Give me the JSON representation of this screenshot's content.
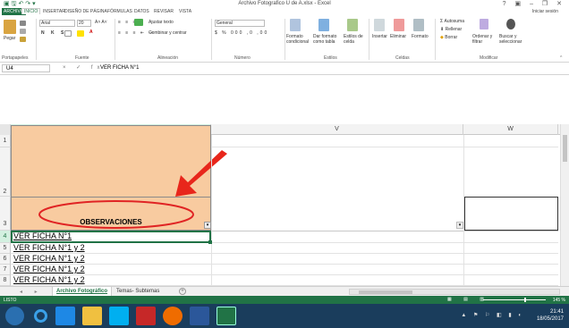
{
  "window": {
    "title": "Archivo Fotografico U de A.xlsx - Excel",
    "controls": "? ▣ – ❐ ✕"
  },
  "tabs": [
    "ARCHIVO",
    "INICIO",
    "INSERTAR",
    "DISEÑO DE PÁGINA",
    "FÓRMULAS",
    "DATOS",
    "REVISAR",
    "VISTA"
  ],
  "signin": "Iniciar sesión",
  "ribbon": {
    "paste": "Pegar",
    "font_name": "Arial",
    "font_size": "20",
    "wrap": "Ajustar texto",
    "merge": "Combinar y centrar",
    "number_format": "General",
    "cond_format": "Formato condicional",
    "as_table": "Dar formato como tabla",
    "cell_styles": "Estilos de celda",
    "insert": "Insertar",
    "delete": "Eliminar",
    "format": "Formato",
    "autosum": "Autosuma",
    "fill": "Rellenar",
    "clear": "Borrar",
    "sort": "Ordenar y filtrar",
    "find": "Buscar y seleccionar",
    "groups": [
      "Portapapeles",
      "Fuente",
      "Alineación",
      "Número",
      "Estilos",
      "Celdas",
      "Modificar"
    ]
  },
  "formula_bar": {
    "name_box": "U4",
    "fx": "× ✓ fx",
    "content": "VER FICHA N°1"
  },
  "columns": [
    "U",
    "V",
    "W"
  ],
  "rows": [
    "1",
    "2",
    "3",
    "4",
    "5",
    "6",
    "7",
    "8"
  ],
  "header_cell": "OBSERVACIONES",
  "data_cells": [
    "VER FICHA N°1",
    "VER FICHA N°1 y 2",
    "VER FICHA N°1 y 2",
    "VER FICHA N°1 y 2",
    "VER FICHA N°1 y 2"
  ],
  "sheets": [
    "Archivo Fotográfico",
    "Temas- Subtemas"
  ],
  "status": {
    "left": "LISTO",
    "zoom": "145 %"
  },
  "clock": {
    "time": "21:41",
    "date": "18/05/2017"
  },
  "colors": {
    "excel_green": "#217346",
    "header_fill": "#f8cba0",
    "ellipse": "#e02424",
    "arrow": "#e8261b",
    "taskbar": "#1a3d5c"
  }
}
